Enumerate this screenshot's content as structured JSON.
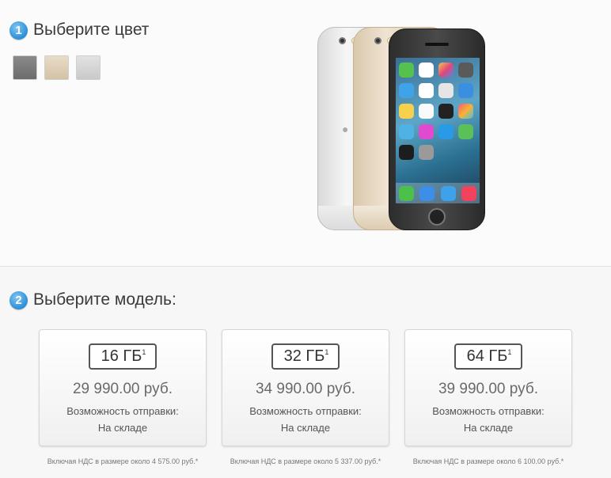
{
  "step1": {
    "number": "1",
    "title": "Выберите цвет"
  },
  "colors": [
    {
      "name": "space-gray",
      "hex": "#7a7a7a"
    },
    {
      "name": "gold",
      "hex": "#dccdb5"
    },
    {
      "name": "silver",
      "hex": "#d0d0d0"
    }
  ],
  "step2": {
    "number": "2",
    "title": "Выберите модель:"
  },
  "models": [
    {
      "capacity": "16 ГБ",
      "footnote": "1",
      "price": "29 990.00 руб.",
      "ship_label": "Возможность отправки:",
      "ship_status": "На складе",
      "vat": "Включая НДС в размере около 4 575.00 руб.*"
    },
    {
      "capacity": "32 ГБ",
      "footnote": "1",
      "price": "34 990.00 руб.",
      "ship_label": "Возможность отправки:",
      "ship_status": "На складе",
      "vat": "Включая НДС в размере около 5 337.00 руб.*"
    },
    {
      "capacity": "64 ГБ",
      "footnote": "1",
      "price": "39 990.00 руб.",
      "ship_label": "Возможность отправки:",
      "ship_status": "На складе",
      "vat": "Включая НДС в размере около 6 100.00 руб.*"
    }
  ],
  "icons": {
    "step_badge": "numbered-circle-icon",
    "phone": "iphone-illustration"
  }
}
